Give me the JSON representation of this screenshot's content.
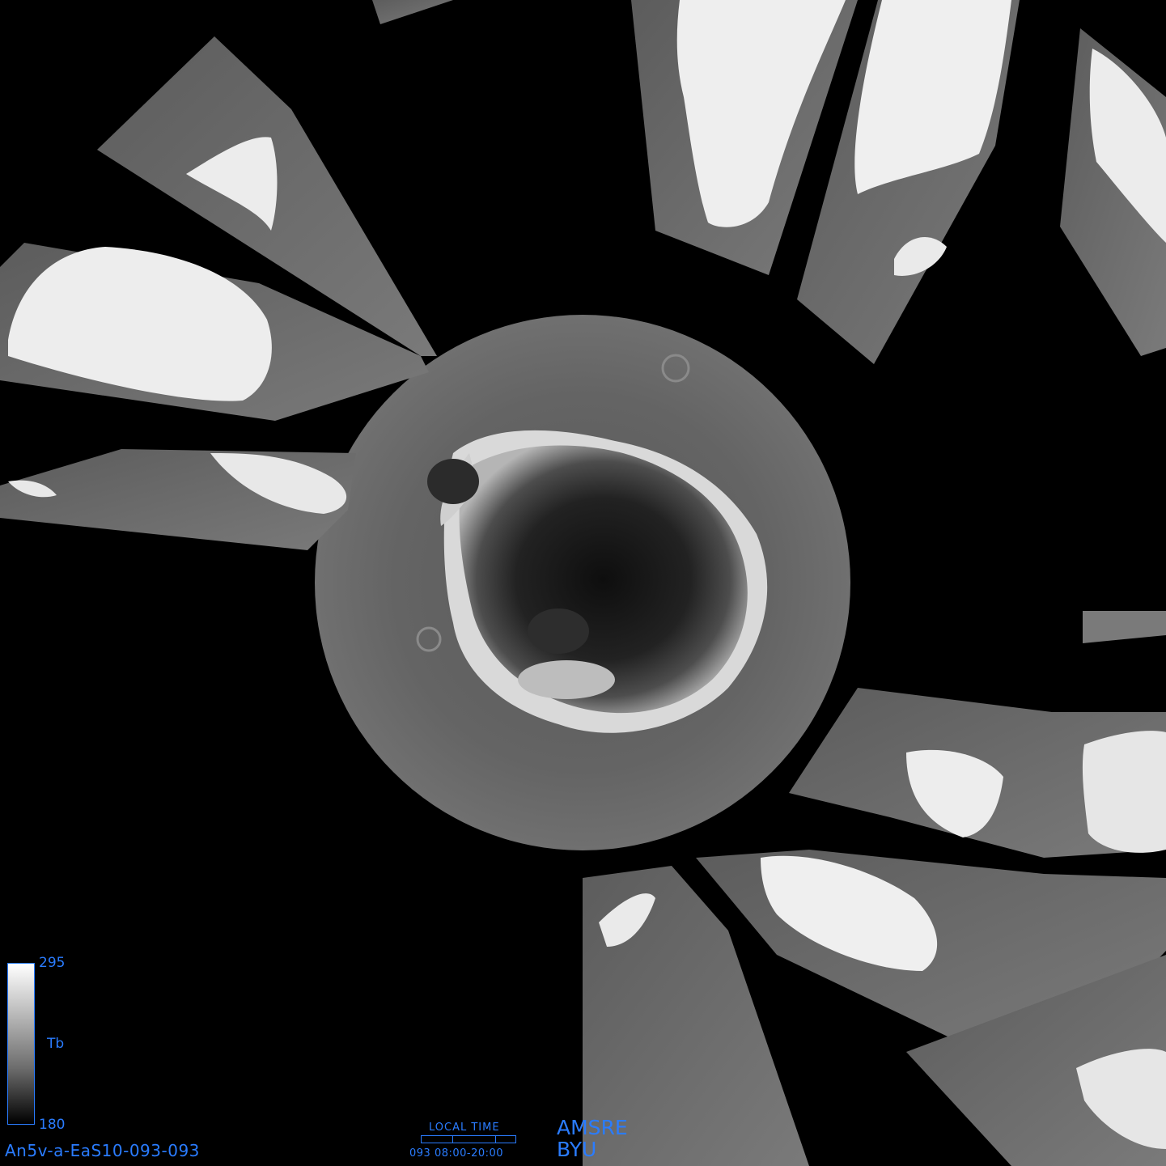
{
  "colorbar": {
    "max": "295",
    "variable": "Tb",
    "min": "180"
  },
  "product_id": "An5v-a-EaS10-093-093",
  "local_time": {
    "title": "LOCAL TIME",
    "range": "093 08:00-20:00"
  },
  "sensor": "AMSRE",
  "organization": "BYU",
  "colors": {
    "label_blue": "#2a7cff",
    "background": "#000000",
    "ocean_gray": "#6a6a6a",
    "land_white": "#f2f2f2",
    "antarctic_dark": "#1e1e1e"
  }
}
